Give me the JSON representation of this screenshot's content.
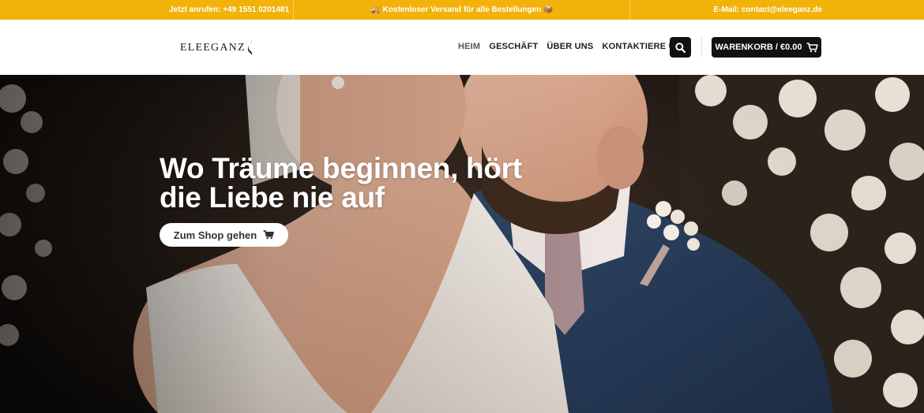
{
  "topbar": {
    "phone": "Jetzt anrufen: +49 1551 0201481",
    "shipping": "🚚 Kostenloser Versand für alle Bestellungen 📦",
    "email": "E-Mail: contact@eleeganz.de",
    "background_color": "#f2b20a"
  },
  "header": {
    "logo_text": "ELEEGANZ",
    "nav": [
      {
        "label": "HEIM",
        "active": true
      },
      {
        "label": "GESCHÄFT",
        "active": false
      },
      {
        "label": "ÜBER UNS",
        "active": false
      },
      {
        "label": "KONTAKTIERE UNS",
        "active": false
      }
    ],
    "search_icon": "search-icon",
    "cart_label": "WARENKORB / €0.00",
    "cart_icon": "cart-icon"
  },
  "hero": {
    "title_line1": "Wo Träume beginnen, hört",
    "title_line2": "die Liebe nie auf",
    "button_label": "Zum Shop gehen",
    "button_icon": "cart-icon"
  }
}
